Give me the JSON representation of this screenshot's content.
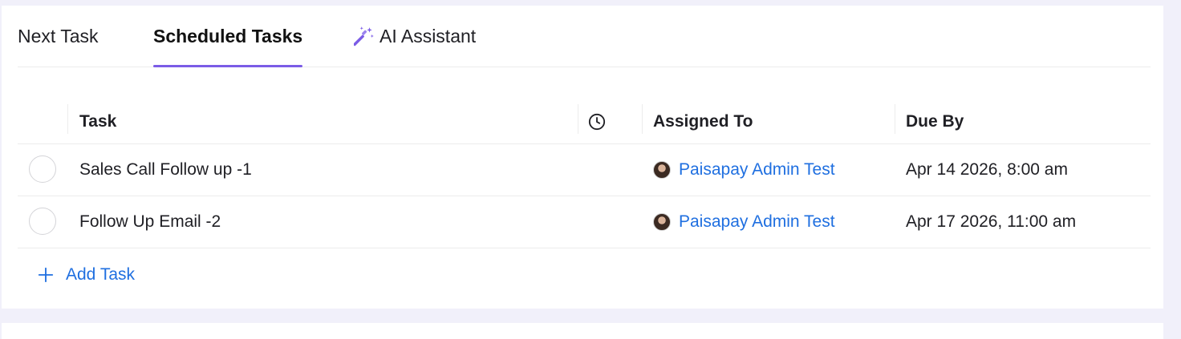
{
  "tabs": [
    {
      "label": "Next Task",
      "active": false
    },
    {
      "label": "Scheduled Tasks",
      "active": true
    },
    {
      "label": "AI Assistant",
      "icon": "magic-wand-icon",
      "active": false
    }
  ],
  "table": {
    "columns": {
      "task": "Task",
      "time_icon": "clock-icon",
      "assigned_to": "Assigned To",
      "due_by": "Due By"
    },
    "rows": [
      {
        "task": "Sales Call Follow up -1",
        "assignee": "Paisapay Admin Test",
        "due": "Apr 14 2026, 8:00 am"
      },
      {
        "task": "Follow Up Email -2",
        "assignee": "Paisapay Admin Test",
        "due": "Apr 17 2026, 11:00 am"
      }
    ]
  },
  "add_task": {
    "label": "Add Task",
    "icon": "plus-icon"
  },
  "colors": {
    "accent": "#7b5ce6",
    "link": "#1f6fe0",
    "background": "#f1f0fa"
  }
}
